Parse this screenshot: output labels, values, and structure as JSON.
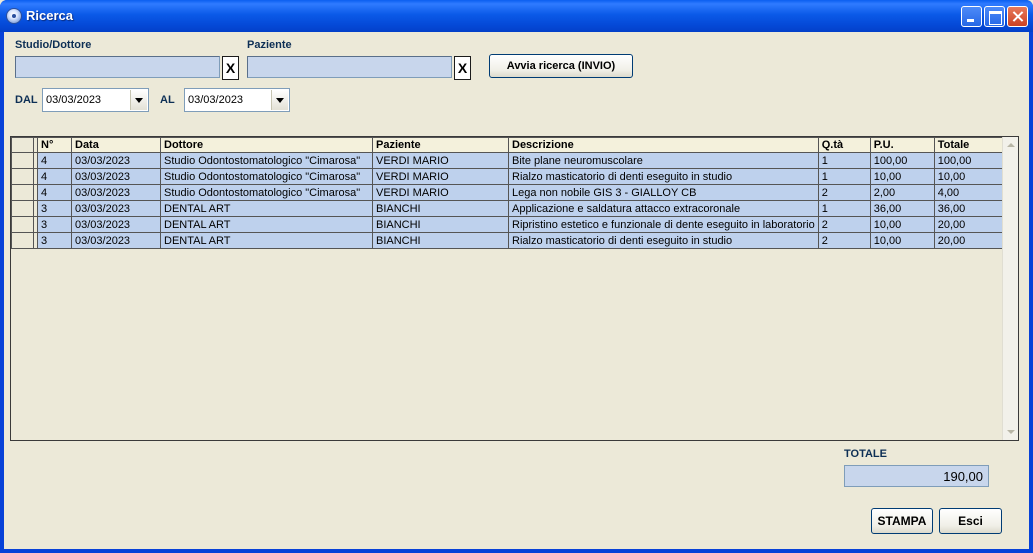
{
  "window": {
    "title": "Ricerca"
  },
  "filters": {
    "studio_label": "Studio/Dottore",
    "studio_value": "",
    "paziente_label": "Paziente",
    "paziente_value": "",
    "clear_label": "X",
    "search_button": "Avvia ricerca (INVIO)",
    "dal_label": "DAL",
    "dal_value": "03/03/2023",
    "al_label": "AL",
    "al_value": "03/03/2023"
  },
  "grid": {
    "columns": [
      "N°",
      "Data",
      "Dottore",
      "Paziente",
      "Descrizione",
      "Q.tà",
      "P.U.",
      "Totale"
    ],
    "rows": [
      [
        "4",
        "03/03/2023",
        "Studio Odontostomatologico \"Cimarosa\"",
        "VERDI MARIO",
        "Bite plane neuromuscolare",
        "1",
        "100,00",
        "100,00"
      ],
      [
        "4",
        "03/03/2023",
        "Studio Odontostomatologico \"Cimarosa\"",
        "VERDI MARIO",
        " Rialzo masticatorio di denti eseguito in studio",
        "1",
        "10,00",
        "10,00"
      ],
      [
        "4",
        "03/03/2023",
        "Studio Odontostomatologico \"Cimarosa\"",
        "VERDI MARIO",
        " Lega non nobile  GIS 3 - GIALLOY CB",
        "2",
        "2,00",
        "4,00"
      ],
      [
        "3",
        "03/03/2023",
        "DENTAL ART",
        "BIANCHI",
        "Applicazione e saldatura attacco extracoronale",
        "1",
        "36,00",
        "36,00"
      ],
      [
        "3",
        "03/03/2023",
        "DENTAL ART",
        "BIANCHI",
        "  Ripristino estetico e funzionale di dente eseguito in laboratorio",
        "2",
        "10,00",
        "20,00"
      ],
      [
        "3",
        "03/03/2023",
        "DENTAL ART",
        "BIANCHI",
        " Rialzo masticatorio di denti eseguito in studio",
        "2",
        "10,00",
        "20,00"
      ]
    ]
  },
  "totale": {
    "label": "TOTALE",
    "value": "190,00"
  },
  "actions": {
    "print": "STAMPA",
    "exit": "Esci"
  },
  "colors": {
    "titlebar": "#0842d8",
    "field_bg": "#c8d6ec",
    "row_bg": "#bed1ed",
    "label": "#0d2f55"
  }
}
